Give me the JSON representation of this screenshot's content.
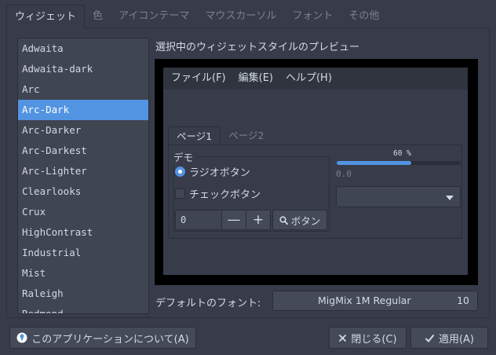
{
  "tabs": [
    "ウィジェット",
    "色",
    "アイコンテーマ",
    "マウスカーソル",
    "フォント",
    "その他"
  ],
  "themes": [
    "Adwaita",
    "Adwaita-dark",
    "Arc",
    "Arc-Dark",
    "Arc-Darker",
    "Arc-Darkest",
    "Arc-Lighter",
    "Clearlooks",
    "Crux",
    "HighContrast",
    "Industrial",
    "Mist",
    "Raleigh",
    "Redmond"
  ],
  "selected_theme": "Arc-Dark",
  "preview": {
    "title": "選択中のウィジェットスタイルのプレビュー",
    "menu": [
      "ファイル(F)",
      "編集(E)",
      "ヘルプ(H)"
    ],
    "tabs": [
      "ページ1",
      "ページ2"
    ],
    "demo_label": "デモ",
    "radio_label": "ラジオボタン",
    "check_label": "チェックボタン",
    "spin_value": "0",
    "spin_minus": "—",
    "spin_plus": "+",
    "search_label": "ボタン",
    "progress_text": "60 %",
    "progress_value": 0.6,
    "scale_value": "0.0"
  },
  "font": {
    "label": "デフォルトのフォント:",
    "name": "MigMix 1M Regular",
    "size": "10"
  },
  "buttons": {
    "about": "このアプリケーションについて(A)",
    "close": "閉じる(C)",
    "apply": "適用(A)"
  },
  "colors": {
    "window_bg": "#383c4a",
    "accent": "#5294e2",
    "text": "#d3dae3"
  },
  "icons": {
    "about": "info-icon",
    "search": "search-icon",
    "close": "close-icon",
    "apply": "check-icon"
  }
}
